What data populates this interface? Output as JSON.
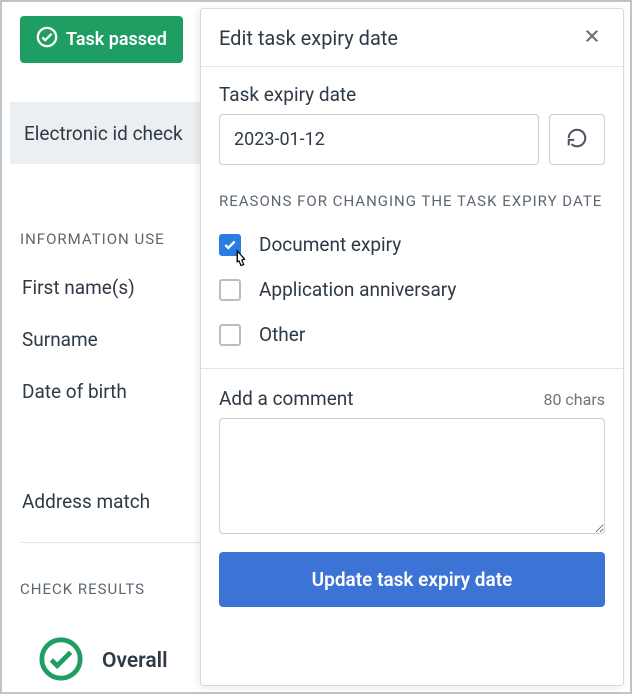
{
  "badge": {
    "label": "Task passed"
  },
  "tab": {
    "label": "Electronic id check"
  },
  "section_info": "INFORMATION USE",
  "fields": {
    "first_name": "First name(s)",
    "surname": "Surname",
    "dob": "Date of birth",
    "address_match": "Address match"
  },
  "section_results": "CHECK RESULTS",
  "overall": "Overall",
  "modal": {
    "title": "Edit task expiry date",
    "expiry_label": "Task expiry date",
    "expiry_value": "2023-01-12",
    "reasons_heading": "REASONS FOR CHANGING THE TASK EXPIRY DATE",
    "reasons": [
      {
        "label": "Document expiry",
        "checked": true
      },
      {
        "label": "Application anniversary",
        "checked": false
      },
      {
        "label": "Other",
        "checked": false
      }
    ],
    "comment_label": "Add a comment",
    "char_count": "80 chars",
    "update_label": "Update task expiry date"
  }
}
